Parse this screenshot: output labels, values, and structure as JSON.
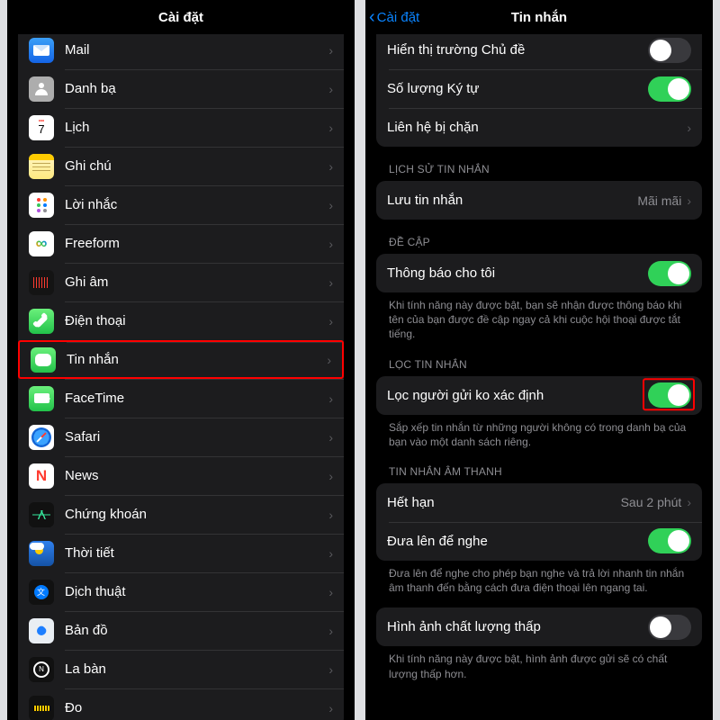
{
  "left": {
    "title": "Cài đặt",
    "items": [
      {
        "label": "Mail"
      },
      {
        "label": "Danh bạ"
      },
      {
        "label": "Lịch"
      },
      {
        "label": "Ghi chú"
      },
      {
        "label": "Lời nhắc"
      },
      {
        "label": "Freeform"
      },
      {
        "label": "Ghi âm"
      },
      {
        "label": "Điện thoại"
      },
      {
        "label": "Tin nhắn"
      },
      {
        "label": "FaceTime"
      },
      {
        "label": "Safari"
      },
      {
        "label": "News"
      },
      {
        "label": "Chứng khoán"
      },
      {
        "label": "Thời tiết"
      },
      {
        "label": "Dịch thuật"
      },
      {
        "label": "Bản đồ"
      },
      {
        "label": "La bàn"
      },
      {
        "label": "Đo"
      }
    ]
  },
  "right": {
    "back": "Cài đặt",
    "title": "Tin nhắn",
    "group1": {
      "show_subject": "Hiển thị trường Chủ đề",
      "char_count": "Số lượng Ký tự",
      "blocked": "Liên hệ bị chặn"
    },
    "history": {
      "header": "LỊCH SỬ TIN NHẮN",
      "keep": "Lưu tin nhắn",
      "keep_value": "Mãi mãi"
    },
    "mentions": {
      "header": "ĐỀ CẬP",
      "notify": "Thông báo cho tôi",
      "footer": "Khi tính năng này được bật, bạn sẽ nhận được thông báo khi tên của bạn được đề cập ngay cả khi cuộc hội thoại được tắt tiếng."
    },
    "filter": {
      "header": "LỌC TIN NHẮN",
      "filter_unknown": "Lọc người gửi ko xác định",
      "footer": "Sắp xếp tin nhắn từ những người không có trong danh bạ của bạn vào một danh sách riêng."
    },
    "audio": {
      "header": "TIN NHẮN ÂM THANH",
      "expire": "Hết hạn",
      "expire_value": "Sau 2 phút",
      "raise": "Đưa lên để nghe",
      "footer": "Đưa lên để nghe cho phép bạn nghe và trả lời nhanh tin nhắn âm thanh đến bằng cách đưa điện thoại lên ngang tai."
    },
    "lowq": {
      "label": "Hình ảnh chất lượng thấp",
      "footer": "Khi tính năng này được bật, hình ảnh được gửi sẽ có chất lượng thấp hơn."
    }
  }
}
